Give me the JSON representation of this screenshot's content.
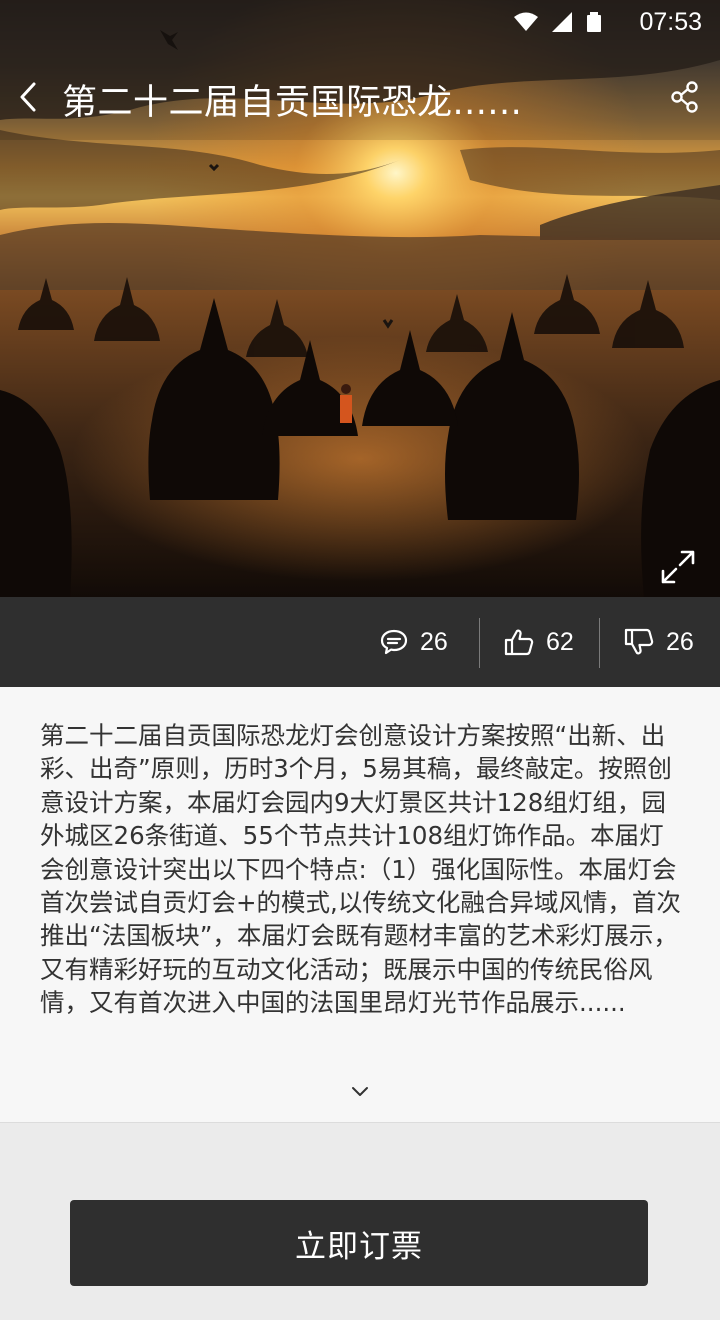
{
  "status_bar": {
    "time": "07:53"
  },
  "header": {
    "title": "第二十二届自贡国际恐龙......"
  },
  "stats": {
    "comments": "26",
    "likes": "62",
    "dislikes": "26"
  },
  "description": {
    "text": "第二十二届自贡国际恐龙灯会创意设计方案按照“出新、出彩、出奇”原则，历时3个月，5易其稿，最终敲定。按照创意设计方案，本届灯会园内9大灯景区共计128组灯组，园外城区26条街道、55个节点共计108组灯饰作品。本届灯会创意设计突出以下四个特点:（1）强化国际性。本届灯会首次尝试自贡灯会+的模式,以传统文化融合异域风情，首次推出“法国板块”，本届灯会既有题材丰富的艺术彩灯展示，又有精彩好玩的互动文化活动；既展示中国的传统民俗风情，又有首次进入中国的法国里昂灯光节作品展示......"
  },
  "actions": {
    "book_label": "立即订票"
  },
  "colors": {
    "dark_bar": "#2f2f2f",
    "text": "#333333",
    "panel": "#f7f7f7",
    "page_bg": "#ebebeb"
  }
}
